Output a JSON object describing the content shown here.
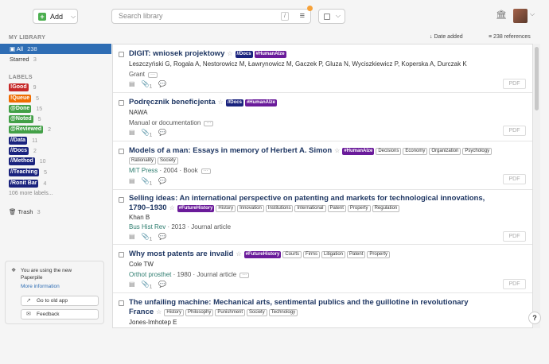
{
  "topbar": {
    "add_label": "Add",
    "search_placeholder": "Search library",
    "search_shortcut": "/"
  },
  "sidebar": {
    "my_library_label": "MY LIBRARY",
    "all": {
      "label": "All",
      "count": "238"
    },
    "starred": {
      "label": "Starred",
      "count": "3"
    },
    "labels_label": "LABELS",
    "labels": [
      {
        "name": "!Good",
        "count": "9",
        "color": "#c62828"
      },
      {
        "name": "!Queue",
        "count": "5",
        "color": "#ef6c00"
      },
      {
        "name": "@Done",
        "count": "15",
        "color": "#43a047"
      },
      {
        "name": "@Noted",
        "count": "5",
        "color": "#43a047"
      },
      {
        "name": "@Reviewed",
        "count": "2",
        "color": "#43a047"
      },
      {
        "name": "//Data",
        "count": "11",
        "color": "#1a237e"
      },
      {
        "name": "//Docs",
        "count": "2",
        "color": "#1a237e"
      },
      {
        "name": "//Method",
        "count": "10",
        "color": "#1a237e"
      },
      {
        "name": "//Teaching",
        "count": "5",
        "color": "#1a237e"
      },
      {
        "name": "/Ronit Bar",
        "count": "4",
        "color": "#1a237e"
      }
    ],
    "more_labels": "106 more labels...",
    "trash": {
      "label": "Trash",
      "count": "3"
    },
    "promo": {
      "text_line1": "You are using the new",
      "text_line2": "Paperpile",
      "more_info": "More information",
      "old_app": "Go to old app",
      "feedback": "Feedback"
    }
  },
  "list_header": {
    "sort_label": "Date added",
    "refs_label": "238 references"
  },
  "items": [
    {
      "title": "DIGIT: wniosek projektowy",
      "tags": [
        {
          "text": "//Docs",
          "color": "#1a237e"
        },
        {
          "text": "#HumanAIze",
          "color": "#6a1b9a"
        }
      ],
      "authors": "Leszczyński G, Rogala A, Nestorowicz M, Ławrynowicz M, Gaczek P, Gluza N, Wyciszkiewicz P, Koperska A, Durczak K",
      "meta_journal": "",
      "meta_rest": "Grant",
      "pdf": "PDF"
    },
    {
      "title": "Podręcznik beneficjenta",
      "tags": [
        {
          "text": "//Docs",
          "color": "#1a237e"
        },
        {
          "text": "#HumanAIze",
          "color": "#6a1b9a"
        }
      ],
      "authors": "NAWA",
      "meta_journal": "",
      "meta_rest": "Manual or documentation",
      "pdf": "PDF"
    },
    {
      "title": "Models of a man: Essays in memory of Herbert A. Simon",
      "tags": [
        {
          "text": "#HumanAIze",
          "color": "#6a1b9a"
        },
        {
          "text": "Decisions"
        },
        {
          "text": "Economy"
        },
        {
          "text": "Organization"
        },
        {
          "text": "Psychology"
        },
        {
          "text": "Rationality"
        },
        {
          "text": "Society"
        }
      ],
      "authors": "",
      "meta_journal": "MIT Press",
      "meta_rest": " · 2004 · Book",
      "pdf": "PDF"
    },
    {
      "title": "Selling ideas: An international perspective on patenting and markets for technological innovations, 1790–1930",
      "tags": [
        {
          "text": "#FutureHistory",
          "color": "#6a1b9a"
        },
        {
          "text": "History"
        },
        {
          "text": "Innovation"
        },
        {
          "text": "Institutions"
        },
        {
          "text": "International"
        },
        {
          "text": "Patent"
        },
        {
          "text": "Property"
        },
        {
          "text": "Regulation"
        }
      ],
      "authors": "Khan B",
      "meta_journal": "Bus Hist Rev",
      "meta_rest": " · 2013 · Journal article",
      "pdf": "PDF"
    },
    {
      "title": "Why most patents are invalid",
      "tags": [
        {
          "text": "#FutureHistory",
          "color": "#6a1b9a"
        },
        {
          "text": "Courts"
        },
        {
          "text": "Firms"
        },
        {
          "text": "Litigation"
        },
        {
          "text": "Patent"
        },
        {
          "text": "Property"
        }
      ],
      "authors": "Cole TW",
      "meta_journal": "Orthot prosthet",
      "meta_rest": " · 1980 · Journal article",
      "pdf": "PDF"
    },
    {
      "title": "The unfailing machine: Mechanical arts, sentimental publics and the guillotine in revolutionary France",
      "tags": [
        {
          "text": "History"
        },
        {
          "text": "Philosophy"
        },
        {
          "text": "Punishment"
        },
        {
          "text": "Society"
        },
        {
          "text": "Technology"
        }
      ],
      "authors": "Jones-Imhotep E",
      "meta_journal": "",
      "meta_rest": "",
      "pdf": ""
    }
  ],
  "icon_counts": {
    "attachments": "1"
  }
}
